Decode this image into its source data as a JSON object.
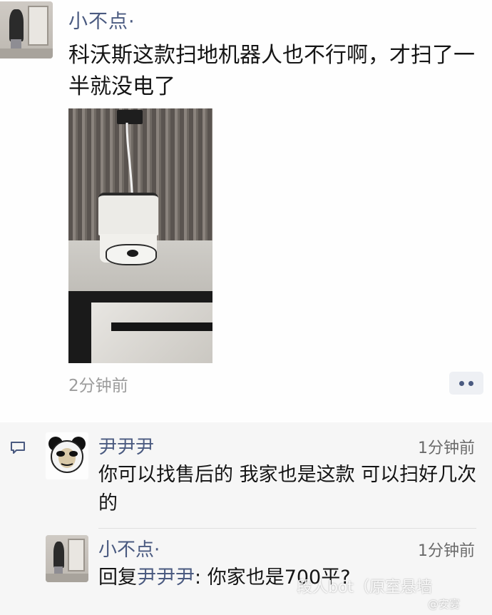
{
  "post": {
    "author": "小不点·",
    "text": "科沃斯这款扫地机器人也不行啊，才扫了一半就没电了",
    "time": "2分钟前",
    "more_icon": "more-dots-icon"
  },
  "comments": [
    {
      "author": "尹尹尹",
      "time": "1分钟前",
      "text": "你可以找售后的 我家也是这款 可以扫好几次的"
    },
    {
      "author": "小不点·",
      "time": "1分钟前",
      "reply_prefix": "回复",
      "reply_target": "尹尹尹",
      "reply_colon": ":",
      "text": " 你家也是700平?"
    }
  ],
  "watermark": {
    "main": "段人bot（原室悬墙",
    "sub": "@安宴"
  },
  "colors": {
    "name_blue": "#4a5a80",
    "comment_bg": "#f6f6f6",
    "time_gray": "#9c9c9c"
  }
}
